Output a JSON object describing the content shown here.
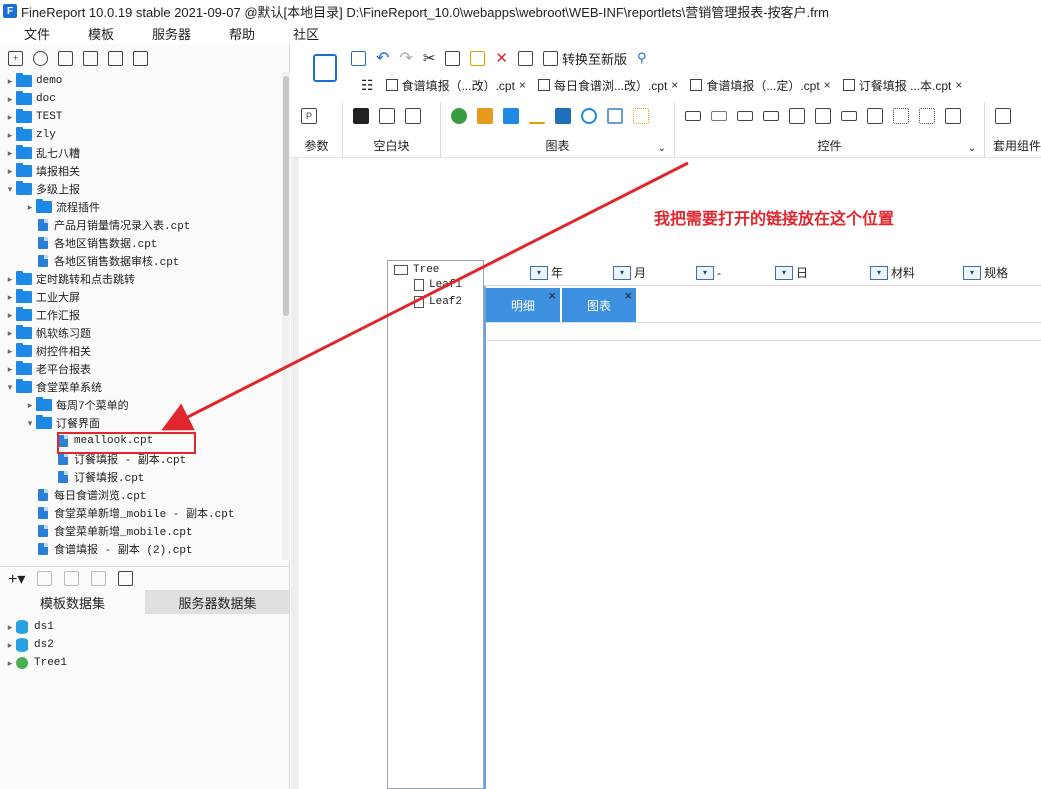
{
  "title": "FineReport 10.0.19 stable 2021-09-07 @默认[本地目录]    D:\\FineReport_10.0\\webapps\\webroot\\WEB-INF\\reportlets\\营销管理报表-按客户.frm",
  "menu": [
    "文件",
    "模板",
    "服务器",
    "帮助",
    "社区"
  ],
  "tree": [
    {
      "label": "demo",
      "type": "folder",
      "level": 0
    },
    {
      "label": "doc",
      "type": "folder",
      "level": 0
    },
    {
      "label": "TEST",
      "type": "folder",
      "level": 0
    },
    {
      "label": "zly",
      "type": "folder",
      "level": 0
    },
    {
      "label": "乱七八糟",
      "type": "folder",
      "level": 0
    },
    {
      "label": "填报相关",
      "type": "folder",
      "level": 0
    },
    {
      "label": "多级上报",
      "type": "folder",
      "level": 0,
      "expanded": true
    },
    {
      "label": "流程插件",
      "type": "folder",
      "level": 1
    },
    {
      "label": "产品月销量情况录入表.cpt",
      "type": "file",
      "level": 1
    },
    {
      "label": "各地区销售数据.cpt",
      "type": "file",
      "level": 1
    },
    {
      "label": "各地区销售数据审核.cpt",
      "type": "file",
      "level": 1
    },
    {
      "label": "定时跳转和点击跳转",
      "type": "folder",
      "level": 0
    },
    {
      "label": "工业大屏",
      "type": "folder",
      "level": 0
    },
    {
      "label": "工作汇报",
      "type": "folder",
      "level": 0
    },
    {
      "label": "帆软练习题",
      "type": "folder",
      "level": 0
    },
    {
      "label": "树控件相关",
      "type": "folder",
      "level": 0
    },
    {
      "label": "老平台报表",
      "type": "folder",
      "level": 0
    },
    {
      "label": "食堂菜单系统",
      "type": "folder",
      "level": 0,
      "expanded": true
    },
    {
      "label": "每周7个菜单的",
      "type": "folder",
      "level": 1
    },
    {
      "label": "订餐界面",
      "type": "folder",
      "level": 1,
      "expanded": true
    },
    {
      "label": "meallook.cpt",
      "type": "file",
      "level": 2
    },
    {
      "label": "订餐填报 - 副本.cpt",
      "type": "file",
      "level": 2
    },
    {
      "label": "订餐填报.cpt",
      "type": "file",
      "level": 2
    },
    {
      "label": "每日食谱浏览.cpt",
      "type": "file",
      "level": 1
    },
    {
      "label": "食堂菜单新增_mobile - 副本.cpt",
      "type": "file",
      "level": 1
    },
    {
      "label": "食堂菜单新增_mobile.cpt",
      "type": "file",
      "level": 1
    },
    {
      "label": "食谱填报 - 副本 (2).cpt",
      "type": "file",
      "level": 1
    }
  ],
  "dataset_tabs": [
    "模板数据集",
    "服务器数据集"
  ],
  "datasets": [
    {
      "label": "ds1",
      "icon": "database-icon"
    },
    {
      "label": "ds2",
      "icon": "database-icon"
    },
    {
      "label": "Tree1",
      "icon": "tree-icon"
    }
  ],
  "toolbar": {
    "convert_label": "转换至新版"
  },
  "tabs": [
    "食谱填报（...改）.cpt",
    "每日食谱浏...改）.cpt",
    "食谱填报（...定）.cpt",
    "订餐填报 ...本.cpt"
  ],
  "ribbon": {
    "param": "参数",
    "blank": "空白块",
    "chart": "图表",
    "widget": "控件",
    "component": "套用组件"
  },
  "canvas": {
    "tree_root": "Tree",
    "tree_leaves": [
      "Leaf1",
      "Leaf2"
    ],
    "filters": [
      "年",
      "月",
      "-",
      "日",
      "材料",
      "规格"
    ],
    "tab_buttons": [
      "明细",
      "图表"
    ]
  },
  "annotation": "我把需要打开的链接放在这个位置"
}
